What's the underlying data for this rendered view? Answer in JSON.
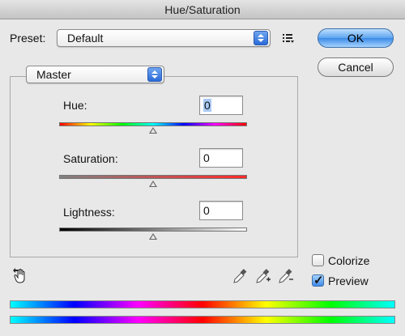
{
  "window": {
    "title": "Hue/Saturation"
  },
  "preset": {
    "label": "Preset:",
    "value": "Default",
    "menu_icon": "preset-options-icon"
  },
  "buttons": {
    "ok": "OK",
    "cancel": "Cancel"
  },
  "channel": {
    "value": "Master"
  },
  "hue": {
    "label": "Hue:",
    "value": "0",
    "slider_level": 0.5
  },
  "saturation": {
    "label": "Saturation:",
    "value": "0",
    "slider_level": 0.5
  },
  "lightness": {
    "label": "Lightness:",
    "value": "0",
    "slider_level": 0.5
  },
  "options": {
    "colorize": {
      "label": "Colorize",
      "checked": false
    },
    "preview": {
      "label": "Preview",
      "checked": true
    }
  },
  "tools": [
    "targeted-adjustment-hand-icon",
    "eyedropper-icon",
    "eyedropper-plus-icon",
    "eyedropper-minus-icon"
  ]
}
